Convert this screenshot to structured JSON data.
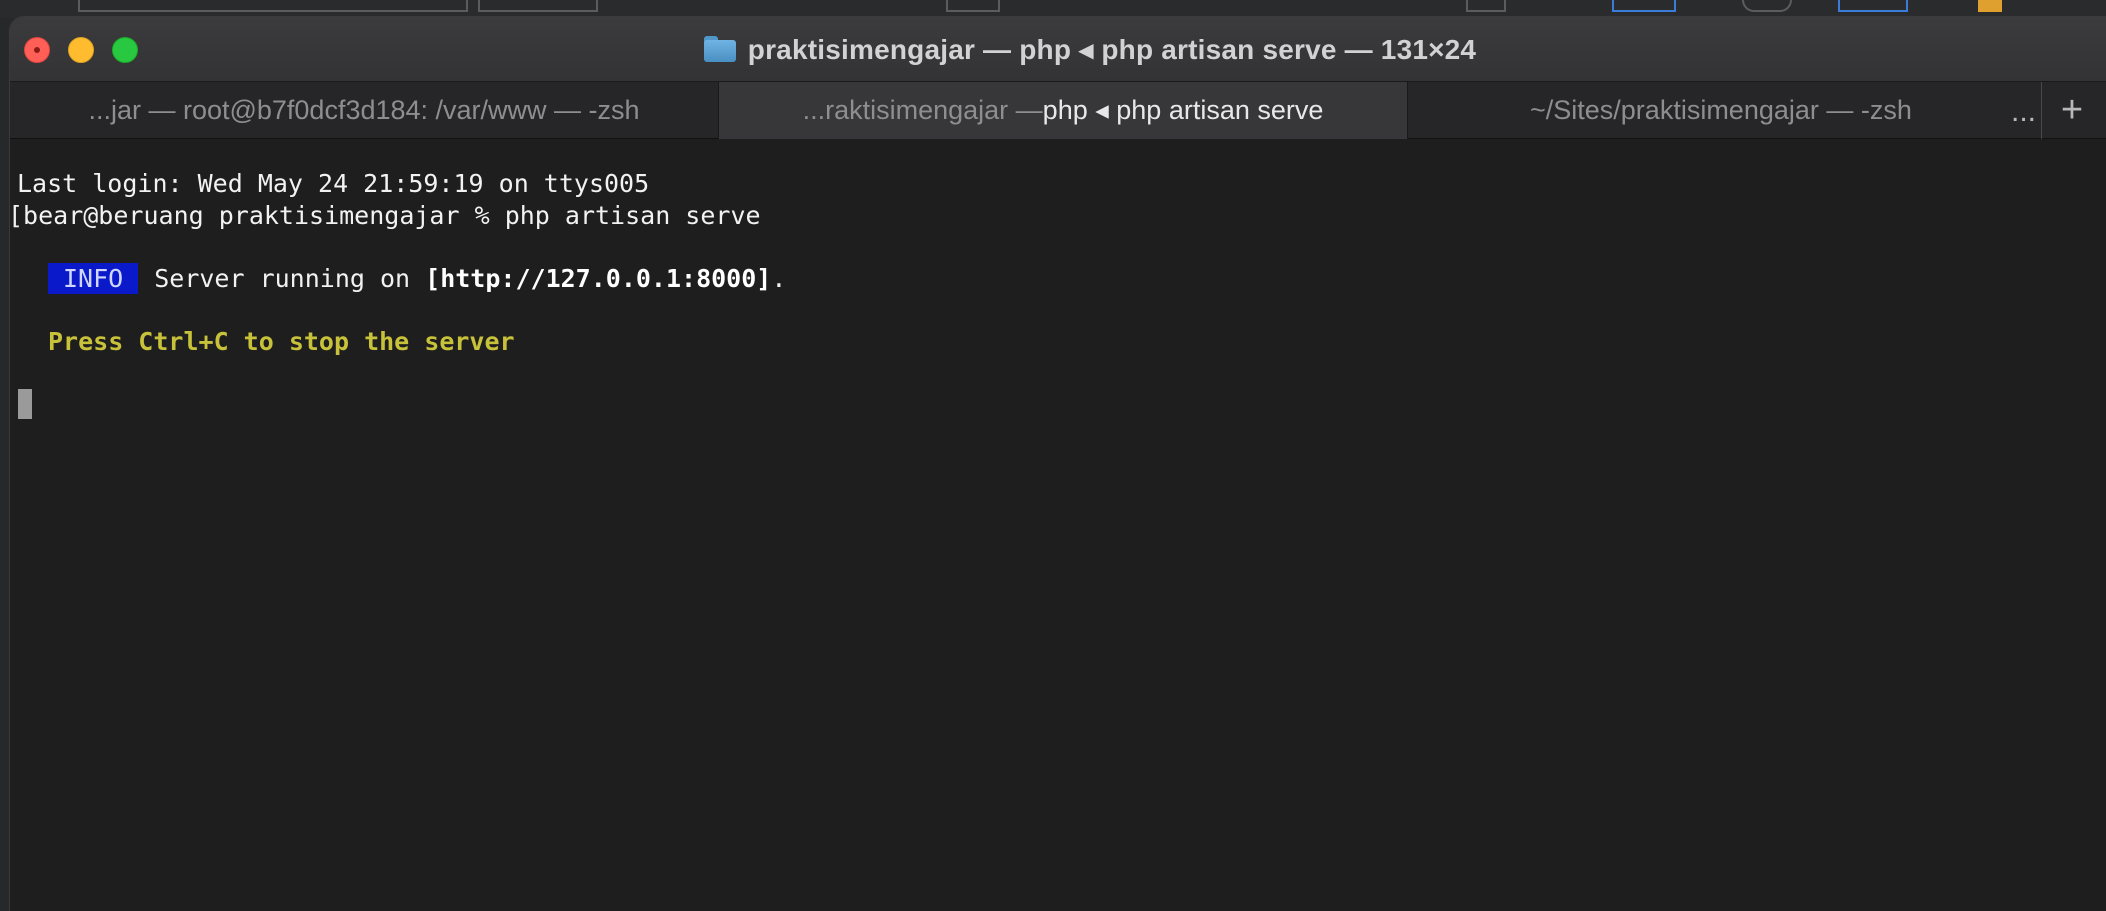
{
  "window": {
    "title": "praktisimengajar — php ◂ php artisan serve — 131×24"
  },
  "tabs": [
    {
      "label": "...jar — root@b7f0dcf3d184: /var/www — -zsh"
    },
    {
      "label_dim": "...raktisimengajar — ",
      "label_bright": "php ◂ php artisan serve"
    },
    {
      "label": "~/Sites/praktisimengajar — -zsh"
    }
  ],
  "tabbar": {
    "overflow": "...",
    "add": "+"
  },
  "terminal": {
    "line1": "Last login: Wed May 24 21:59:19 on ttys005",
    "line2": "[bear@beruang praktisimengajar % php artisan serve",
    "info_badge": "INFO",
    "server_text": "Server running on ",
    "server_url": "[http://127.0.0.1:8000]",
    "server_end": ".",
    "stop_hint": "Press Ctrl+C to stop the server"
  },
  "colors": {
    "info_badge_bg": "#0a1acb",
    "hint_yellow": "#c8c23a",
    "close": "#ff5f57",
    "minimize": "#febc2e",
    "maximize": "#28c840"
  }
}
